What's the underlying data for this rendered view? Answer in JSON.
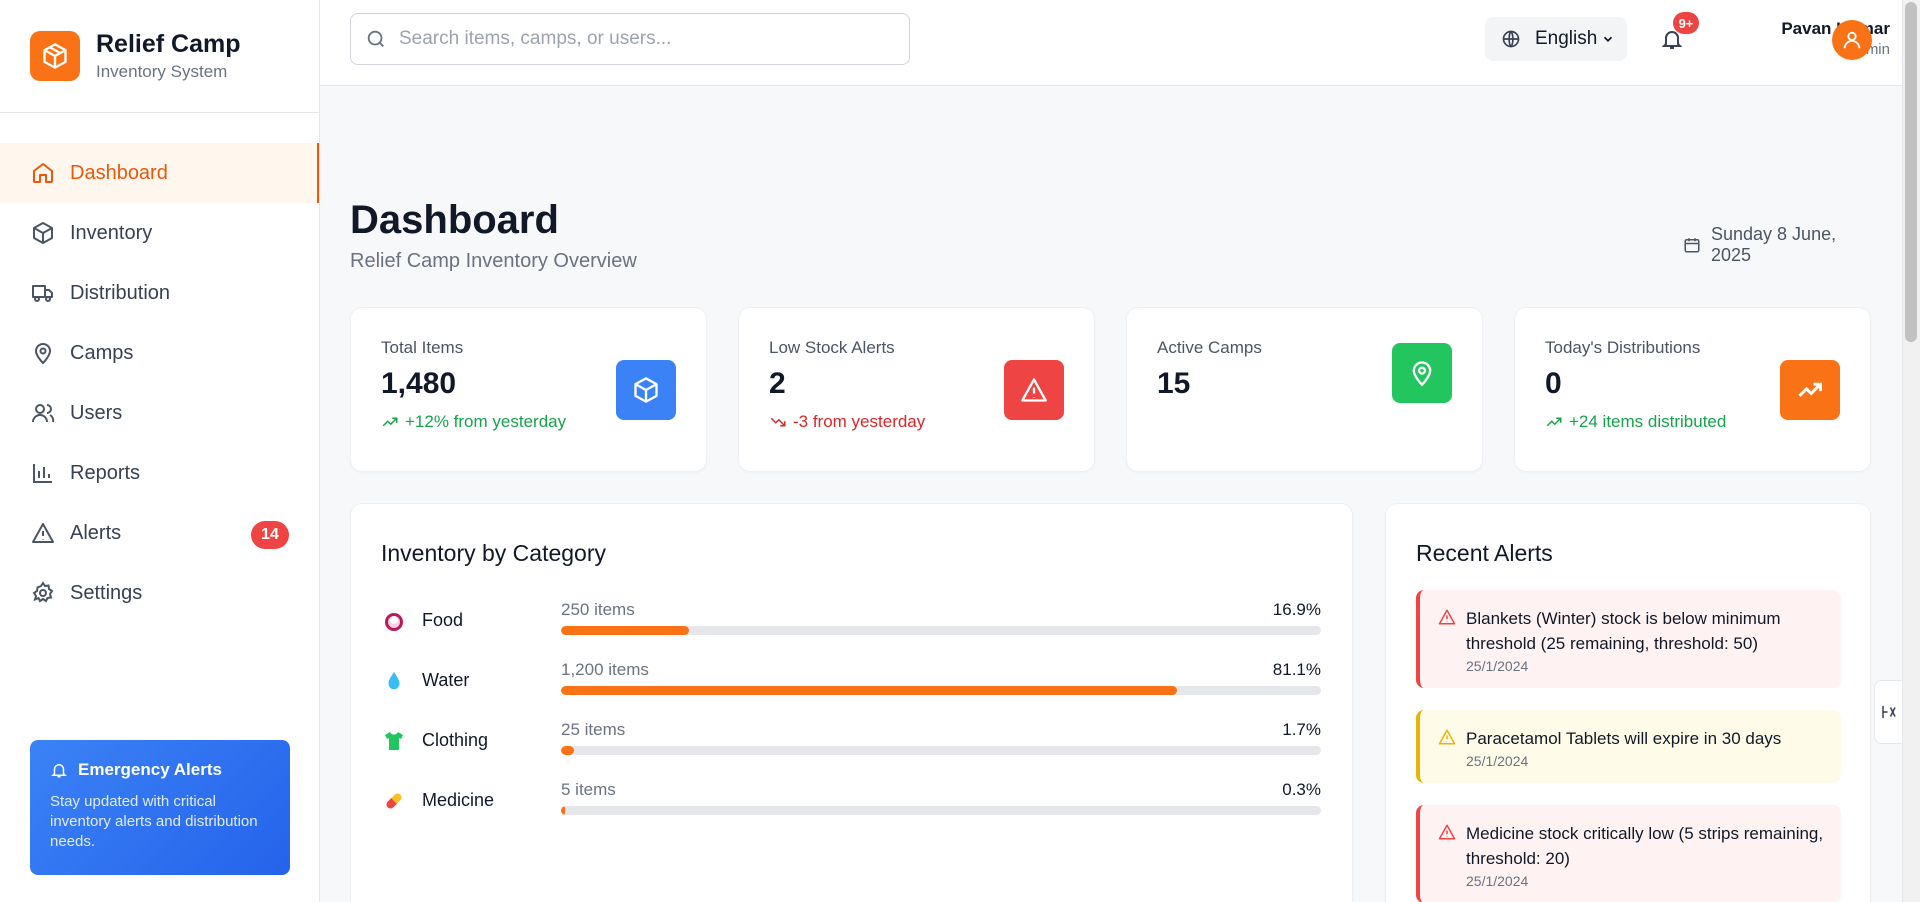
{
  "brand": {
    "title": "Relief Camp",
    "subtitle": "Inventory System"
  },
  "sidebar": {
    "items": [
      {
        "label": "Dashboard",
        "icon": "home-icon",
        "active": true
      },
      {
        "label": "Inventory",
        "icon": "box-icon"
      },
      {
        "label": "Distribution",
        "icon": "truck-icon"
      },
      {
        "label": "Camps",
        "icon": "map-pin-icon"
      },
      {
        "label": "Users",
        "icon": "users-icon"
      },
      {
        "label": "Reports",
        "icon": "bar-chart-icon"
      },
      {
        "label": "Alerts",
        "icon": "alert-triangle-icon",
        "badge": "14"
      },
      {
        "label": "Settings",
        "icon": "gear-icon"
      }
    ],
    "emergency": {
      "title": "Emergency Alerts",
      "text": "Stay updated with critical inventory alerts and distribution needs."
    }
  },
  "header": {
    "search_placeholder": "Search items, camps, or users...",
    "language": "English",
    "notification_badge": "9+",
    "user_name": "Pavan Kumar",
    "user_role": "Admin"
  },
  "page": {
    "title": "Dashboard",
    "subtitle": "Relief Camp Inventory Overview",
    "date": "Sunday 8 June, 2025"
  },
  "stats": [
    {
      "label": "Total Items",
      "value": "1,480",
      "trend": "+12% from yesterday",
      "trend_dir": "up",
      "color": "#3b82f6",
      "icon": "box-icon"
    },
    {
      "label": "Low Stock Alerts",
      "value": "2",
      "trend": "-3 from yesterday",
      "trend_dir": "down",
      "color": "#ef4444",
      "icon": "alert-triangle-icon"
    },
    {
      "label": "Active Camps",
      "value": "15",
      "trend": "",
      "color": "#22c55e",
      "icon": "map-pin-icon"
    },
    {
      "label": "Today's Distributions",
      "value": "0",
      "trend": "+24 items distributed",
      "trend_dir": "up",
      "color": "#f97316",
      "icon": "trending-up-icon"
    }
  ],
  "inventory": {
    "title": "Inventory by Category",
    "categories": [
      {
        "name": "Food",
        "count": "250 items",
        "percent": "16.9%",
        "fraction": 0.169,
        "icon": "food-icon"
      },
      {
        "name": "Water",
        "count": "1,200 items",
        "percent": "81.1%",
        "fraction": 0.811,
        "icon": "water-drop-icon"
      },
      {
        "name": "Clothing",
        "count": "25 items",
        "percent": "1.7%",
        "fraction": 0.017,
        "icon": "shirt-icon"
      },
      {
        "name": "Medicine",
        "count": "5 items",
        "percent": "0.3%",
        "fraction": 0.003,
        "icon": "pill-icon"
      }
    ]
  },
  "alerts": {
    "title": "Recent Alerts",
    "items": [
      {
        "message": "Blankets (Winter) stock is below minimum threshold (25 remaining, threshold: 50)",
        "date": "25/1/2024",
        "level": "red"
      },
      {
        "message": "Paracetamol Tablets will expire in 30 days",
        "date": "25/1/2024",
        "level": "yellow"
      },
      {
        "message": "Medicine stock critically low (5 strips remaining, threshold: 20)",
        "date": "25/1/2024",
        "level": "red"
      }
    ]
  },
  "colors": {
    "accent": "#f97316",
    "accent_dark": "#ea580c",
    "danger": "#ef4444",
    "success": "#16a34a",
    "info": "#3b82f6"
  }
}
